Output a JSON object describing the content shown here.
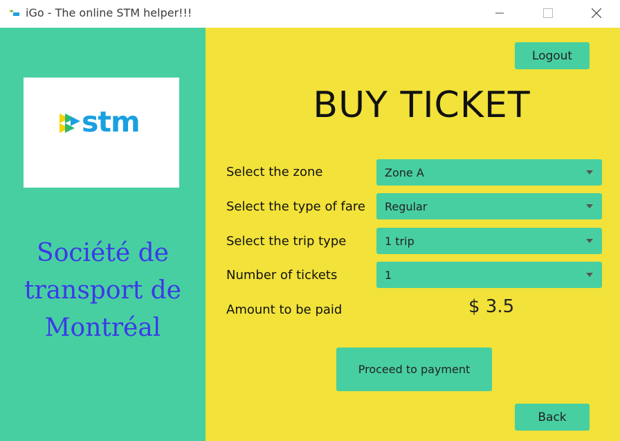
{
  "window": {
    "title": "iGo - The online STM helper!!!",
    "icons": [
      "app-icon",
      "minimize-icon",
      "maximize-icon",
      "close-icon"
    ]
  },
  "sidebar": {
    "logo_text": "stm",
    "org_name": "Société de\ntransport de\nMontréal"
  },
  "main": {
    "logout_label": "Logout",
    "heading": "BUY TICKET",
    "fields": [
      {
        "label": "Select the zone",
        "value": "Zone A"
      },
      {
        "label": "Select the type of fare",
        "value": "Regular"
      },
      {
        "label": "Select the trip type",
        "value": "1 trip"
      },
      {
        "label": "Number of tickets",
        "value": "1"
      }
    ],
    "amount_label": "Amount to be paid",
    "amount_value": "$ 3.5",
    "proceed_label": "Proceed to payment",
    "back_label": "Back"
  },
  "colors": {
    "sidebar_bg": "#48cfa1",
    "main_bg": "#f2e23a",
    "control_bg": "#48cfa1",
    "org_name_color": "#3b39e8",
    "logo_text_color": "#1aa0e1"
  }
}
